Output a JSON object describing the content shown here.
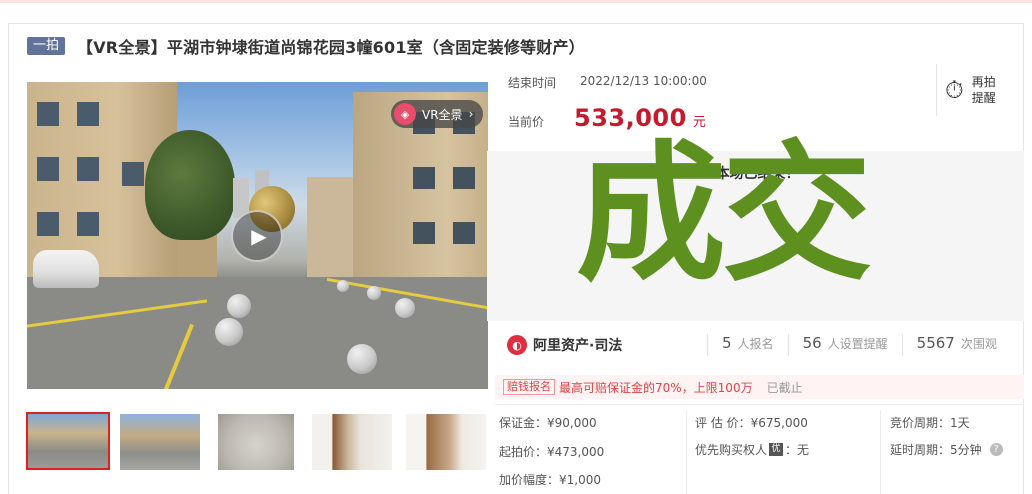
{
  "header": {
    "tag": "一拍",
    "title": "【VR全景】平湖市钟埭街道尚锦花园3幢601室（含固定装修等财产）"
  },
  "media": {
    "vr_label": "VR全景",
    "vr_chevron": "›",
    "play_glyph": "▶",
    "thumbnails": [
      {
        "name": "street-view",
        "selected": true
      },
      {
        "name": "street-view-2",
        "selected": false
      },
      {
        "name": "ceiling",
        "selected": false
      },
      {
        "name": "hallway",
        "selected": false
      },
      {
        "name": "room",
        "selected": false
      }
    ]
  },
  "auction": {
    "end_label": "结束时间",
    "end_time": "2022/12/13 10:00:00",
    "price_label": "当前价",
    "price": "533,000",
    "price_unit": "元",
    "remind_line1": "再拍",
    "remind_line2": "提醒",
    "ended_text": "本场已结束！",
    "stamp": "成交"
  },
  "platform": {
    "name": "阿里资产·司法",
    "signups": "5",
    "signups_label": "人报名",
    "reminders": "56",
    "reminders_label": "人设置提醒",
    "views": "5567",
    "views_label": "次围观"
  },
  "deposit": {
    "tag": "赔钱报名",
    "text": "最高可赔保证金的70%，上限100万",
    "status": "已截止"
  },
  "details": {
    "deposit": "保证金：¥90,000",
    "valuation": "评 估 价：¥675,000",
    "bid_cycle": "竞价周期：1天",
    "start_price": "起拍价：¥473,000",
    "priority_label": "优先购买权人",
    "priority_icon": "优",
    "priority_value": "：无",
    "delay_cycle": "延时周期：5分钟",
    "increment": "加价幅度：¥1,000"
  },
  "colors": {
    "accent": "#c41a2b",
    "stamp": "#5e9020",
    "tag_bg": "#617399"
  }
}
